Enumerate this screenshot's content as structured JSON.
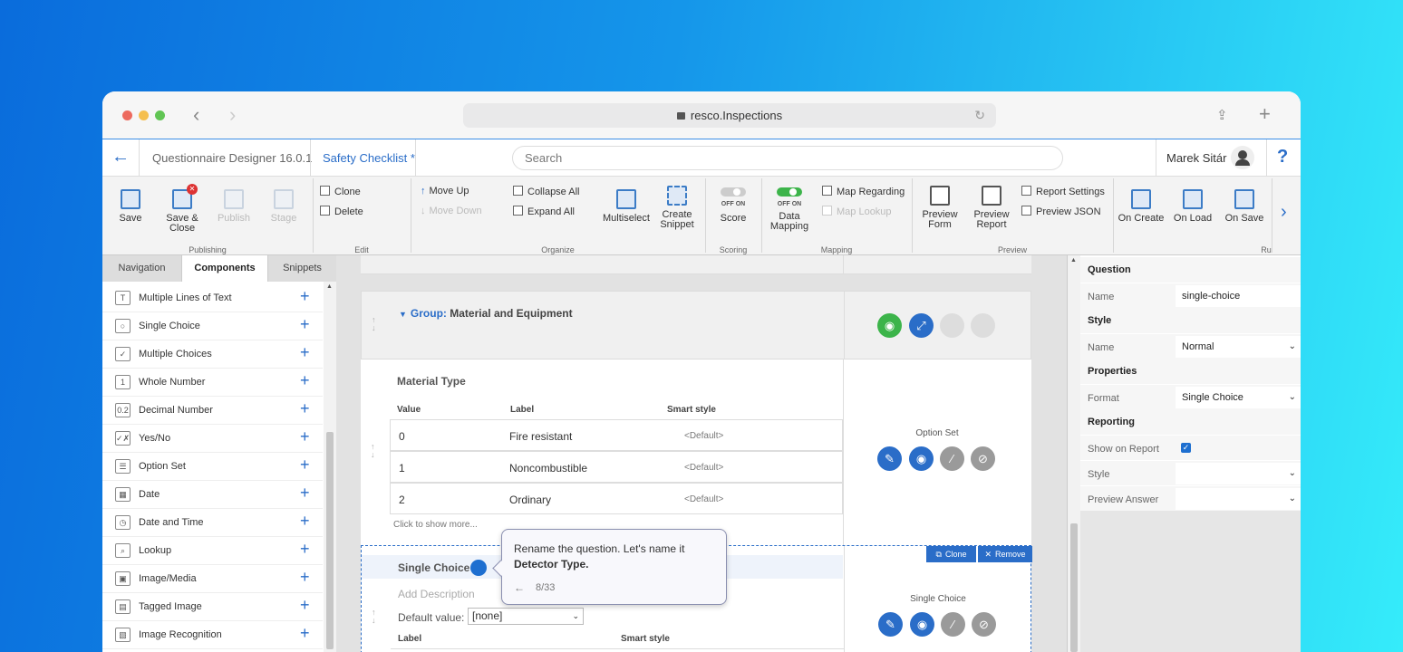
{
  "browser": {
    "url": "resco.Inspections"
  },
  "appbar": {
    "title": "Questionnaire Designer 16.0.1",
    "document": "Safety Checklist *",
    "search_placeholder": "Search",
    "user": "Marek Sitár",
    "help": "?"
  },
  "ribbon": {
    "save": "Save",
    "save_close_1": "Save &",
    "save_close_2": "Close",
    "publish": "Publish",
    "stage": "Stage",
    "group_publishing": "Publishing",
    "clone": "Clone",
    "delete": "Delete",
    "group_edit": "Edit",
    "move_up": "Move Up",
    "move_down": "Move Down",
    "collapse_all": "Collapse All",
    "expand_all": "Expand All",
    "multiselect": "Multiselect",
    "create_snippet_1": "Create",
    "create_snippet_2": "Snippet",
    "group_organize": "Organize",
    "score_toggle": "OFF  ON",
    "score": "Score",
    "group_scoring": "Scoring",
    "dm_toggle": "OFF  ON",
    "data_mapping_1": "Data",
    "data_mapping_2": "Mapping",
    "map_regarding": "Map Regarding",
    "map_lookup": "Map Lookup",
    "group_mapping": "Mapping",
    "preview_form_1": "Preview",
    "preview_form_2": "Form",
    "preview_report_1": "Preview",
    "preview_report_2": "Report",
    "report_settings": "Report Settings",
    "preview_json": "Preview JSON",
    "group_preview": "Preview",
    "on_create": "On Create",
    "on_load": "On Load",
    "on_save": "On Save",
    "group_rules": "Ru"
  },
  "left": {
    "tabs": [
      "Navigation",
      "Components",
      "Snippets"
    ],
    "components": [
      {
        "icon": "T",
        "label": "Multiple Lines of Text"
      },
      {
        "icon": "○",
        "label": "Single Choice"
      },
      {
        "icon": "✓",
        "label": "Multiple Choices"
      },
      {
        "icon": "1",
        "label": "Whole Number"
      },
      {
        "icon": "0.2",
        "label": "Decimal Number"
      },
      {
        "icon": "✓✗",
        "label": "Yes/No"
      },
      {
        "icon": "☰",
        "label": "Option Set"
      },
      {
        "icon": "▦",
        "label": "Date"
      },
      {
        "icon": "◷",
        "label": "Date and Time"
      },
      {
        "icon": "⌕",
        "label": "Lookup"
      },
      {
        "icon": "▣",
        "label": "Image/Media"
      },
      {
        "icon": "▤",
        "label": "Tagged Image"
      },
      {
        "icon": "▧",
        "label": "Image Recognition"
      }
    ],
    "add_symbol": "+"
  },
  "center": {
    "group_prefix": "Group:",
    "group_name": "Material and Equipment",
    "q1": {
      "title": "Material Type",
      "col_value": "Value",
      "col_label": "Label",
      "col_style": "Smart style",
      "rows": [
        {
          "value": "0",
          "label": "Fire resistant",
          "style": "<Default>"
        },
        {
          "value": "1",
          "label": "Noncombustible",
          "style": "<Default>"
        },
        {
          "value": "2",
          "label": "Ordinary",
          "style": "<Default>"
        }
      ],
      "show_more": "Click to show more...",
      "type": "Option Set"
    },
    "q2": {
      "title": "Single Choice",
      "description_placeholder": "Add Description",
      "default_label": "Default value:",
      "default_value": "[none]",
      "col_label": "Label",
      "col_style": "Smart style",
      "type": "Single Choice",
      "clone": "Clone",
      "remove": "Remove"
    }
  },
  "tooltip": {
    "line1": "Rename the question. Let's name it",
    "line2": "Detector Type.",
    "progress": "8/33"
  },
  "right": {
    "sec_question": "Question",
    "name_label": "Name",
    "name_value": "single-choice",
    "sec_style": "Style",
    "style_name_label": "Name",
    "style_name_value": "Normal",
    "sec_properties": "Properties",
    "format_label": "Format",
    "format_value": "Single Choice",
    "sec_reporting": "Reporting",
    "show_on_report_label": "Show on Report",
    "show_on_report": true,
    "style_label": "Style",
    "preview_answer_label": "Preview Answer"
  },
  "colors": {
    "accent": "#2a6dc8",
    "green": "#3cb44a",
    "grey_btn": "#9a9a9a"
  }
}
